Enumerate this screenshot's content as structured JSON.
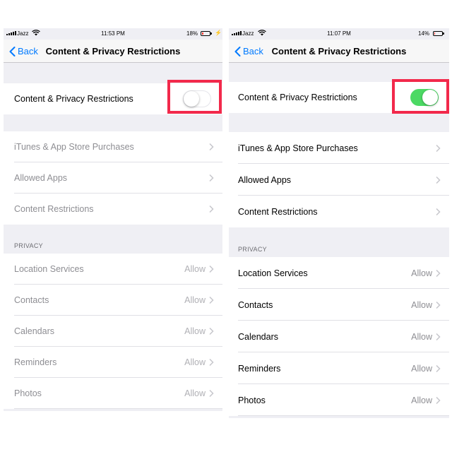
{
  "colors": {
    "accent": "#007aff",
    "toggle_on": "#4cd964",
    "highlight": "#f2294b",
    "battery_low": "#ff3b30"
  },
  "left": {
    "status": {
      "carrier": "Jazz",
      "time": "11:53 PM",
      "battery": "18%",
      "battery_level": 0.18,
      "charging": true
    },
    "nav": {
      "back": "Back",
      "title": "Content & Privacy Restrictions"
    },
    "master": {
      "label": "Content & Privacy Restrictions",
      "enabled": false
    },
    "store_items": [
      {
        "label": "iTunes & App Store Purchases"
      },
      {
        "label": "Allowed Apps"
      },
      {
        "label": "Content Restrictions"
      }
    ],
    "privacy_header": "PRIVACY",
    "privacy_items": [
      {
        "label": "Location Services",
        "value": "Allow"
      },
      {
        "label": "Contacts",
        "value": "Allow"
      },
      {
        "label": "Calendars",
        "value": "Allow"
      },
      {
        "label": "Reminders",
        "value": "Allow"
      },
      {
        "label": "Photos",
        "value": "Allow"
      }
    ]
  },
  "right": {
    "status": {
      "carrier": "Jazz",
      "time": "11:07 PM",
      "battery": "14%",
      "battery_level": 0.14,
      "charging": false
    },
    "nav": {
      "back": "Back",
      "title": "Content & Privacy Restrictions"
    },
    "master": {
      "label": "Content & Privacy Restrictions",
      "enabled": true
    },
    "store_items": [
      {
        "label": "iTunes & App Store Purchases"
      },
      {
        "label": "Allowed Apps"
      },
      {
        "label": "Content Restrictions"
      }
    ],
    "privacy_header": "PRIVACY",
    "privacy_items": [
      {
        "label": "Location Services",
        "value": "Allow"
      },
      {
        "label": "Contacts",
        "value": "Allow"
      },
      {
        "label": "Calendars",
        "value": "Allow"
      },
      {
        "label": "Reminders",
        "value": "Allow"
      },
      {
        "label": "Photos",
        "value": "Allow"
      }
    ]
  }
}
